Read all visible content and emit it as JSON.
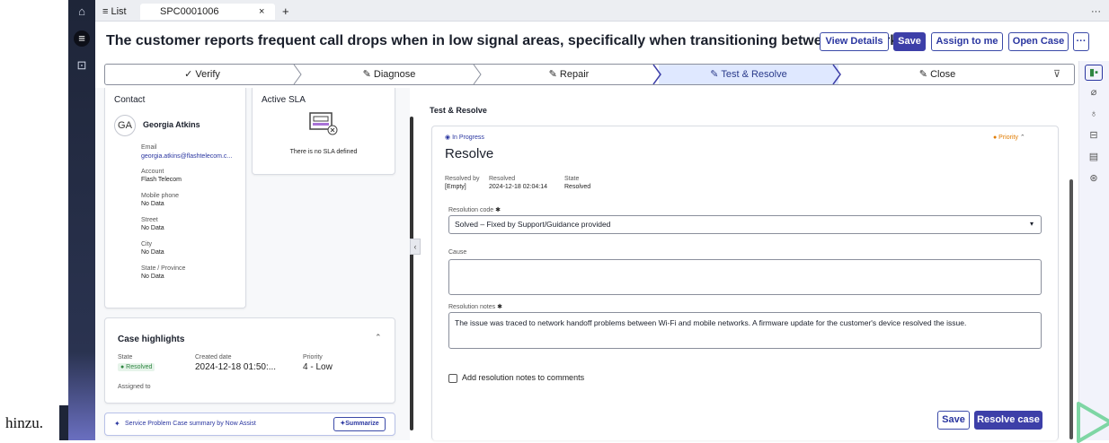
{
  "tabs": {
    "list_label": "≡ List",
    "case_tab": "SPC0001006",
    "close": "×",
    "add": "+",
    "more": "···"
  },
  "case": {
    "title": "The customer reports frequent call drops when in low signal areas, specifically when transitioning between networks."
  },
  "header_buttons": {
    "view_details": "View Details",
    "save": "Save",
    "assign": "Assign to me",
    "open_case": "Open Case",
    "more": "···"
  },
  "stages": [
    {
      "label": "✓ Verify"
    },
    {
      "label": "✎ Diagnose"
    },
    {
      "label": "✎ Repair"
    },
    {
      "label": "✎ Test & Resolve"
    },
    {
      "label": "✎ Close"
    }
  ],
  "contact": {
    "heading": "Contact",
    "initials": "GA",
    "name": "Georgia Atkins",
    "email_label": "Email",
    "email": "georgia.atkins@flashtelecom.c...",
    "account_label": "Account",
    "account": "Flash Telecom",
    "mobile_label": "Mobile phone",
    "mobile": "No Data",
    "street_label": "Street",
    "street": "No Data",
    "city_label": "City",
    "city": "No Data",
    "state_label": "State / Province",
    "state": "No Data"
  },
  "sla": {
    "heading": "Active SLA",
    "empty": "There is no SLA defined"
  },
  "highlights": {
    "heading": "Case highlights",
    "state_label": "State",
    "state": "● Resolved",
    "created_label": "Created date",
    "created": "2024-12-18 01:50:...",
    "priority_label": "Priority",
    "priority": "4 - Low",
    "assigned_label": "Assigned to"
  },
  "assist": {
    "label": "Service Problem Case summary by Now Assist",
    "button": "Summarize"
  },
  "resolve": {
    "section_title": "Test & Resolve",
    "status": "In Progress",
    "priority_tag": "● Priority",
    "heading": "Resolve",
    "resolved_by_label": "Resolved by",
    "resolved_by": "[Empty]",
    "resolved_label": "Resolved",
    "resolved": "2024-12-18 02:04:14",
    "state_label": "State",
    "state": "Resolved",
    "code_label": "Resolution code",
    "code_value": "Solved – Fixed by Support/Guidance provided",
    "cause_label": "Cause",
    "notes_label": "Resolution notes",
    "notes_value": "The issue was traced to network handoff problems between Wi-Fi and mobile networks. A firmware update for the customer's device resolved the issue.",
    "add_to_comments": "Add resolution notes to comments",
    "save": "Save",
    "resolve_case": "Resolve case"
  },
  "caption": "hinzu.",
  "colors": {
    "brand": "#3d3fa8",
    "resolved_green": "#2e8540",
    "priority_orange": "#e07b00",
    "play_green": "#7ed6a4"
  }
}
